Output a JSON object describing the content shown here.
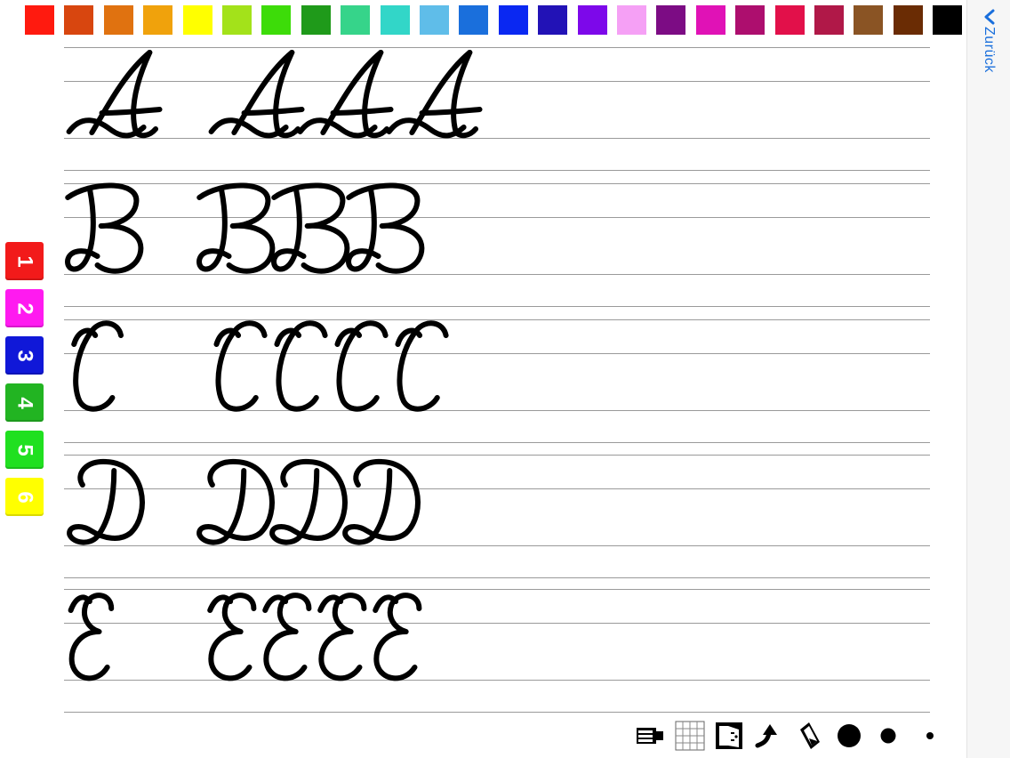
{
  "palette": {
    "colors": [
      "#ff1a0f",
      "#d8460f",
      "#e07210",
      "#f0a20c",
      "#ffff00",
      "#a3e21a",
      "#3ddc09",
      "#1f9a1a",
      "#36d48a",
      "#32d6c8",
      "#5fbde9",
      "#1a6fdc",
      "#0a28f2",
      "#2212b6",
      "#7d08ea",
      "#f5a0f5",
      "#7c0c84",
      "#e012b6",
      "#ad0e6e",
      "#e2104a",
      "#b01848",
      "#8a5424",
      "#6a2c04",
      "#000000"
    ]
  },
  "back": {
    "label": "Zurück",
    "color": "#1a6fdc"
  },
  "worksheet": {
    "rows": [
      {
        "letter": "A"
      },
      {
        "letter": "B"
      },
      {
        "letter": "C"
      },
      {
        "letter": "D"
      },
      {
        "letter": "E"
      }
    ]
  },
  "layers": [
    {
      "label": "1",
      "color": "#f21a1a"
    },
    {
      "label": "2",
      "color": "#ff1af0"
    },
    {
      "label": "3",
      "color": "#1018d8"
    },
    {
      "label": "4",
      "color": "#22b422"
    },
    {
      "label": "5",
      "color": "#20e020"
    },
    {
      "label": "6",
      "color": "#ffff00"
    }
  ],
  "toolbar": {
    "tools": [
      {
        "icon": "eraser-icon"
      },
      {
        "icon": "grid-icon"
      },
      {
        "icon": "exit-door-icon"
      },
      {
        "icon": "undo-arrow-icon"
      },
      {
        "icon": "rubber-icon"
      },
      {
        "icon": "brush-large-icon"
      },
      {
        "icon": "brush-medium-icon"
      },
      {
        "icon": "brush-small-icon"
      }
    ]
  }
}
